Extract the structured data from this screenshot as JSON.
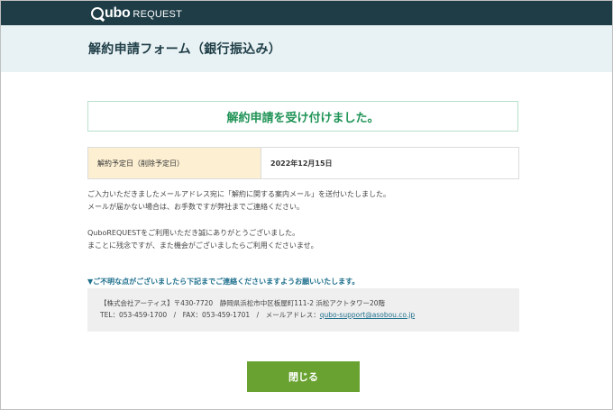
{
  "brand": {
    "logo_main": "ubo",
    "logo_sub": "REQUEST"
  },
  "page": {
    "title": "解約申請フォーム（銀行振込み）"
  },
  "result": {
    "message": "解約申請を受け付けました。"
  },
  "schedule": {
    "label": "解約予定日（削除予定日）",
    "value": "2022年12月15日"
  },
  "notices": {
    "line1": "ご入力いただきましたメールアドレス宛に「解約に関する案内メール」を送付いたしました。",
    "line2": "メールが届かない場合は、お手数ですが弊社までご連絡ください。",
    "line3": "QuboREQUESTをご利用いただき誠にありがとうございました。",
    "line4": "まことに残念ですが、また機会がございましたらご利用くださいませ。"
  },
  "contact": {
    "heading": "▼ご不明な点がございましたら下記までご連絡くださいますようお願いいたします。",
    "address": "【株式会社アーティス】〒430-7720　静岡県浜松市中区板屋町111-2 浜松アクトタワー20階",
    "phone_fax": "TEL：053-459-1700　/　FAX：053-459-1701　/　メールアドレス：",
    "email": "qubo-support@asobou.co.jp"
  },
  "actions": {
    "close_label": "閉じる"
  },
  "colors": {
    "topbar": "#1e3d47",
    "header_bg": "#e8f1f3",
    "success_text": "#1f9356",
    "label_bg": "#fcefd2",
    "link": "#1d6f8c",
    "button": "#6aa232"
  }
}
